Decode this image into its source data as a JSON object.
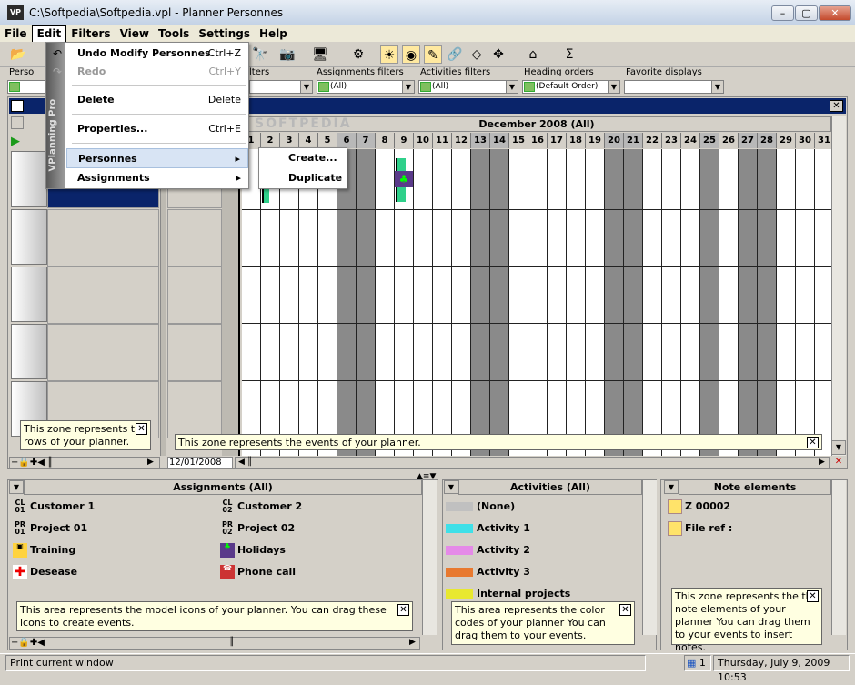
{
  "window": {
    "title": "C:\\Softpedia\\Softpedia.vpl - Planner Personnes",
    "app_icon_text": "VP"
  },
  "menu": [
    "File",
    "Edit",
    "Filters",
    "View",
    "Tools",
    "Settings",
    "Help"
  ],
  "active_menu": "Edit",
  "edit_menu": {
    "side_label": "VPlanning Pro",
    "items": [
      {
        "label": "Undo Modify Personnes",
        "shortcut": "Ctrl+Z",
        "enabled": true
      },
      {
        "label": "Redo",
        "shortcut": "Ctrl+Y",
        "enabled": false
      },
      {
        "label": "Delete",
        "shortcut": "Delete",
        "enabled": true
      },
      {
        "label": "Properties...",
        "shortcut": "Ctrl+E",
        "enabled": true
      },
      {
        "label": "Personnes",
        "shortcut": "",
        "enabled": true
      },
      {
        "label": "Assignments",
        "shortcut": "",
        "enabled": true
      }
    ],
    "submenu": [
      "Create...",
      "Duplicate"
    ]
  },
  "filters": {
    "persons_label": "Perso",
    "filters_label": "lters",
    "assignments_label": "Assignments filters",
    "assignments_value": "(All)",
    "activities_label": "Activities filters",
    "activities_value": "(All)",
    "heading_label": "Heading orders",
    "heading_value": "(Default Order)",
    "favorite_label": "Favorite displays",
    "favorite_value": ""
  },
  "planner": {
    "month": "December 2008 (All)",
    "days": [
      "1",
      "2",
      "3",
      "4",
      "5",
      "6",
      "7",
      "8",
      "9",
      "10",
      "11",
      "12",
      "13",
      "14",
      "15",
      "16",
      "17",
      "18",
      "19",
      "20",
      "21",
      "22",
      "23",
      "24",
      "25",
      "26",
      "27",
      "28",
      "29",
      "30",
      "31"
    ],
    "weekend_days": [
      6,
      7,
      13,
      14,
      20,
      21,
      25,
      27,
      28
    ],
    "rows_hint": "This zone represents the rows of your planner.",
    "events_hint": "This zone represents the events of your planner.",
    "date_value": "12/01/2008",
    "watermark": "SOFTPEDIA"
  },
  "assignments_pane": {
    "title": "Assignments (All)",
    "items": [
      {
        "label": "Customer 1",
        "icon": "CL 01"
      },
      {
        "label": "Customer 2",
        "icon": "CL 02"
      },
      {
        "label": "Project 01",
        "icon": "PR 01"
      },
      {
        "label": "Project 02",
        "icon": "PR 02"
      },
      {
        "label": "Training",
        "icon": "training-icon"
      },
      {
        "label": "Holidays",
        "icon": "palm-tree-icon"
      },
      {
        "label": "Desease",
        "icon": "red-cross-icon"
      },
      {
        "label": "Phone call",
        "icon": "phone-icon"
      }
    ],
    "hint": "This area represents the model icons of your planner. You can drag these icons to create events."
  },
  "activities_pane": {
    "title": "Activities (All)",
    "items": [
      {
        "label": "(None)",
        "color": "#c0c0c0"
      },
      {
        "label": "Activity 1",
        "color": "#3fe0e8"
      },
      {
        "label": "Activity 2",
        "color": "#e58ae8"
      },
      {
        "label": "Activity 3",
        "color": "#e8792f"
      },
      {
        "label": "Internal projects",
        "color": "#e8e82f"
      }
    ],
    "hint": "This area represents the color codes of your planner You can drag them to your events."
  },
  "notes_pane": {
    "title": "Note elements",
    "items": [
      "Z 00002",
      "File ref :"
    ],
    "hint": "This zone represents the the note elements of your planner You can drag them to your events to insert notes."
  },
  "status": {
    "message": "Print current window",
    "count": "1",
    "datetime": "Thursday, July 9, 2009 10:53"
  }
}
